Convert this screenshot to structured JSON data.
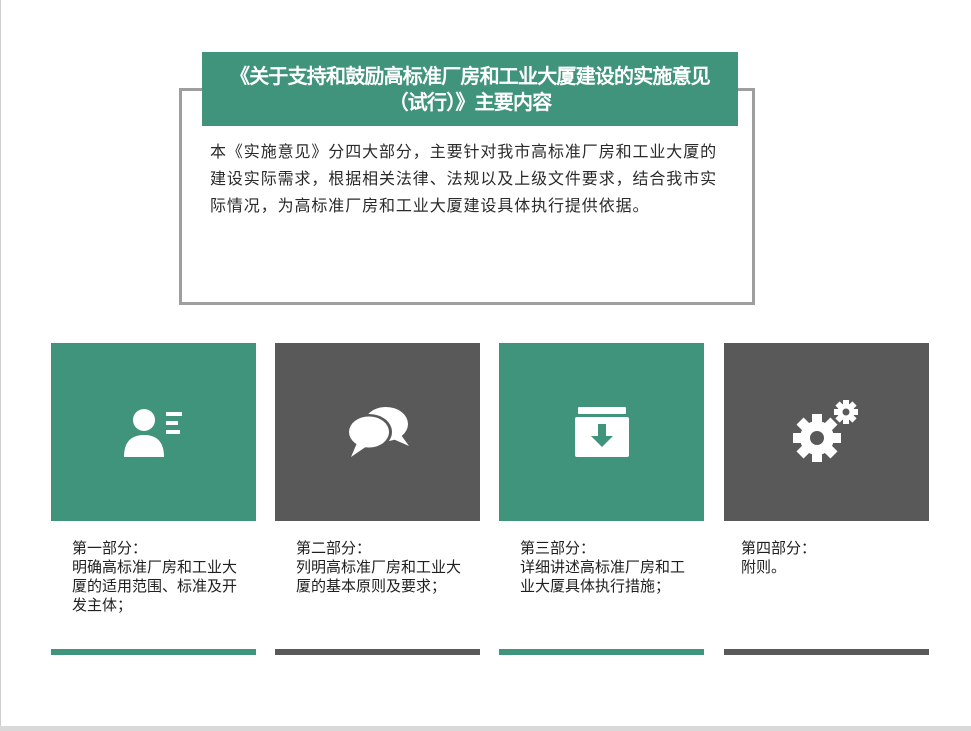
{
  "header": {
    "title_line1": "《关于支持和鼓励高标准厂房和工业大厦建设的实施意见",
    "title_line2": "（试行）》主要内容"
  },
  "intro": {
    "text": "本《实施意见》分四大部分，主要针对我市高标准厂房和工业大厦的建设实际需求，根据相关法律、法规以及上级文件要求，结合我市实际情况，为高标准厂房和工业大厦建设具体执行提供依据。"
  },
  "colors": {
    "green": "#40947b",
    "gray": "#595959",
    "border": "#9e9e9e"
  },
  "cards": [
    {
      "heading": "第一部分：",
      "body": "明确高标准厂房和工业大厦的适用范围、标准及开发主体；",
      "icon": "user-list-icon",
      "color": "green"
    },
    {
      "heading": "第二部分：",
      "body": "列明高标准厂房和工业大厦的基本原则及要求；",
      "icon": "chat-bubbles-icon",
      "color": "gray"
    },
    {
      "heading": "第三部分：",
      "body": "详细讲述高标准厂房和工业大厦具体执行措施；",
      "icon": "archive-download-icon",
      "color": "green"
    },
    {
      "heading": "第四部分：",
      "body": "附则。",
      "icon": "gears-icon",
      "color": "gray"
    }
  ]
}
